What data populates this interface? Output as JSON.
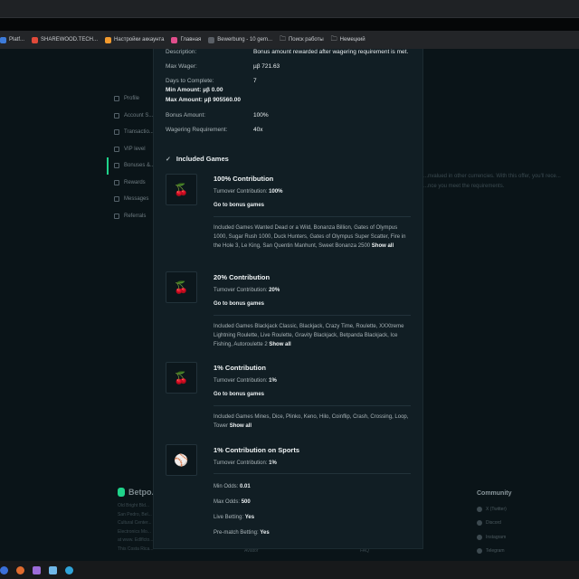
{
  "bookmarks": [
    {
      "label": "Platf...",
      "color": "#3d7bd9"
    },
    {
      "label": "SHAREWOOD.TECH...",
      "color": "#e04a3a"
    },
    {
      "label": "Настройки аккаунта",
      "color": "#f29a2e"
    },
    {
      "label": "Главная",
      "color": "#e14e8c"
    },
    {
      "label": "Bewerbung - 10 gem...",
      "color": "#5a5f66"
    },
    {
      "label": "Поиск работы",
      "color": "#c8cbcf"
    },
    {
      "label": "Немецкий",
      "color": "#c8cbcf"
    }
  ],
  "sidebar": {
    "items": [
      {
        "label": "Profile",
        "active": false
      },
      {
        "label": "Account S...",
        "active": false
      },
      {
        "label": "Transactio...",
        "active": false
      },
      {
        "label": "VIP level",
        "active": false
      },
      {
        "label": "Bonuses &...",
        "active": true
      },
      {
        "label": "Rewards",
        "active": false
      },
      {
        "label": "Messages",
        "active": false
      },
      {
        "label": "Referrals",
        "active": false
      }
    ]
  },
  "background_text": {
    "line1": "...nvalued in other currencies. With this offer, you'll rece...",
    "line2": "...nce you meet the requirements."
  },
  "footer": {
    "logo": "Betpo...",
    "lines": [
      "Old Bright Bld...",
      "San Pedro, Bel...",
      "Cultural Center...",
      "Electronics Mo...",
      "at www. Edlflcto...",
      "This Costa Rica..."
    ],
    "community_title": "Community",
    "community": [
      "X (Twitter)",
      "Discord",
      "Instagram",
      "Telegram"
    ],
    "mid_links": [
      "Aviator",
      "FAQ"
    ]
  },
  "details": {
    "description_label": "Description:",
    "description_value": "Bonus amount rewarded after wagering requirement is met.",
    "max_wager_label": "Max Wager:",
    "max_wager_value": "µβ 721.63",
    "days_label": "Days to Complete:",
    "days_value": "7",
    "min_amount": "Min Amount: µβ 0.00",
    "max_amount": "Max Amount: µβ 905560.00",
    "bonus_amount_label": "Bonus Amount:",
    "bonus_amount_value": "100%",
    "wagering_label": "Wagering Requirement:",
    "wagering_value": "40x"
  },
  "included_games_title": "Included Games",
  "sections": [
    {
      "title": "100% Contribution",
      "turnover_label": "Turnover Contribution:",
      "turnover_value": "100%",
      "link": "Go to bonus games",
      "games": "Included Games Wanted Dead or a Wild, Bonanza Billion, Gates of Olympus 1000, Sugar Rush 1000, Duck Hunters, Gates of Olympus Super Scatter, Fire in the Hole 3, Le King, San Quentin Manhunt, Sweet Bonanza 2500",
      "show_all": "Show all"
    },
    {
      "title": "20% Contribution",
      "turnover_label": "Turnover Contribution:",
      "turnover_value": "20%",
      "link": "Go to bonus games",
      "games": "Included Games Blackjack Classic, Blackjack, Crazy Time, Roulette, XXXtreme Lightning Roulette, Live Roulette, Gravity Blackjack, Betpanda Blackjack, Ice Fishing, Autoroulette 2",
      "show_all": "Show all"
    },
    {
      "title": "1% Contribution",
      "turnover_label": "Turnover Contribution:",
      "turnover_value": "1%",
      "link": "Go to bonus games",
      "games": "Included Games Mines, Dice, Plinko, Keno, Hilo, Coinflip, Crash, Crossing, Loop, Tower",
      "show_all": "Show all"
    },
    {
      "title": "1% Contribution on Sports",
      "turnover_label": "Turnover Contribution:",
      "turnover_value": "1%",
      "min_odds_label": "Min Odds:",
      "min_odds_value": "0.01",
      "max_odds_label": "Max Odds:",
      "max_odds_value": "500",
      "live_label": "Live Betting:",
      "live_value": "Yes",
      "prematch_label": "Pre-match Betting:",
      "prematch_value": "Yes"
    }
  ],
  "icons": {
    "casino": "cherry-icon",
    "sports": "tennis-ball-icon"
  },
  "colors": {
    "accent": "#1fd38a",
    "modal_bg": "#111e24",
    "page_bg": "#0a1418"
  }
}
